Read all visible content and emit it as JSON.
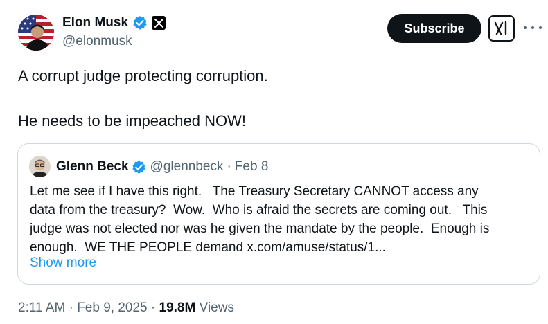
{
  "author": {
    "name": "Elon Musk",
    "handle": "@elonmusk",
    "avatar_icon": "avatar-flag-photo",
    "verified_icon": "verified-badge-icon",
    "affiliate_icon": "x-logo-icon"
  },
  "header": {
    "subscribe_label": "Subscribe",
    "grok_icon": "grok-icon",
    "more_icon": "more-options-icon"
  },
  "post": {
    "line1": "A corrupt judge protecting corruption.",
    "line2": "He needs to be impeached NOW!"
  },
  "quote": {
    "name": "Glenn Beck",
    "handle": "@glennbeck",
    "separator": "·",
    "date": "Feb 8",
    "text": "Let me see if I have this right.   The Treasury Secretary CANNOT access any\ndata from the treasury?  Wow.  Who is afraid the secrets are coming out.   This\njudge was not elected nor was he given the mandate by the people.  Enough is\nenough.  WE THE PEOPLE demand x.com/amuse/status/1...",
    "show_more": "Show more"
  },
  "footer": {
    "time": "2:11 AM",
    "sep1": "·",
    "date": "Feb 9, 2025",
    "sep2": "·",
    "views_count": "19.8M",
    "views_label": "Views"
  },
  "colors": {
    "verified_blue": "#1d9bf0",
    "text_primary": "#0f1419",
    "text_secondary": "#536471",
    "border": "#cfd9de",
    "button_dark": "#0f1419"
  }
}
